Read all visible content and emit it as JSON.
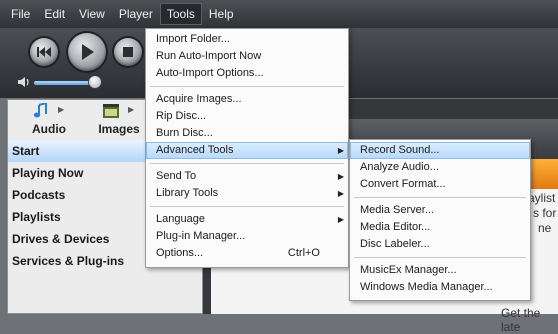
{
  "menubar": {
    "items": [
      "File",
      "Edit",
      "View",
      "Player",
      "Tools",
      "Help"
    ],
    "active": "Tools"
  },
  "transport": {
    "volume_level": 0.85
  },
  "sidebar": {
    "categories": [
      {
        "label": "Audio",
        "icon": "music-note-icon"
      },
      {
        "label": "Images",
        "icon": "film-icon"
      }
    ],
    "items": [
      "Start",
      "Playing Now",
      "Podcasts",
      "Playlists",
      "Drives & Devices",
      "Services & Plug-ins"
    ],
    "selected": "Start"
  },
  "main": {
    "snippets": [
      "aylist",
      "s for",
      "ne",
      "Get the late"
    ]
  },
  "tools_menu": {
    "group1": [
      "Import Folder...",
      "Run Auto-Import Now",
      "Auto-Import Options..."
    ],
    "group2": [
      "Acquire Images...",
      "Rip Disc...",
      "Burn Disc...",
      "Advanced Tools"
    ],
    "group3": [
      "Send To",
      "Library Tools"
    ],
    "group4": [
      "Language",
      "Plug-in Manager...",
      "Options..."
    ],
    "options_shortcut": "Ctrl+O"
  },
  "advanced_menu": {
    "group1": [
      "Record Sound...",
      "Analyze Audio...",
      "Convert Format..."
    ],
    "group2": [
      "Media Server...",
      "Media Editor...",
      "Disc Labeler..."
    ],
    "group3": [
      "MusicEx Manager...",
      "Windows Media Manager..."
    ]
  },
  "colors": {
    "highlight": "#b7d8fb",
    "menubar": "#3a3d42"
  }
}
